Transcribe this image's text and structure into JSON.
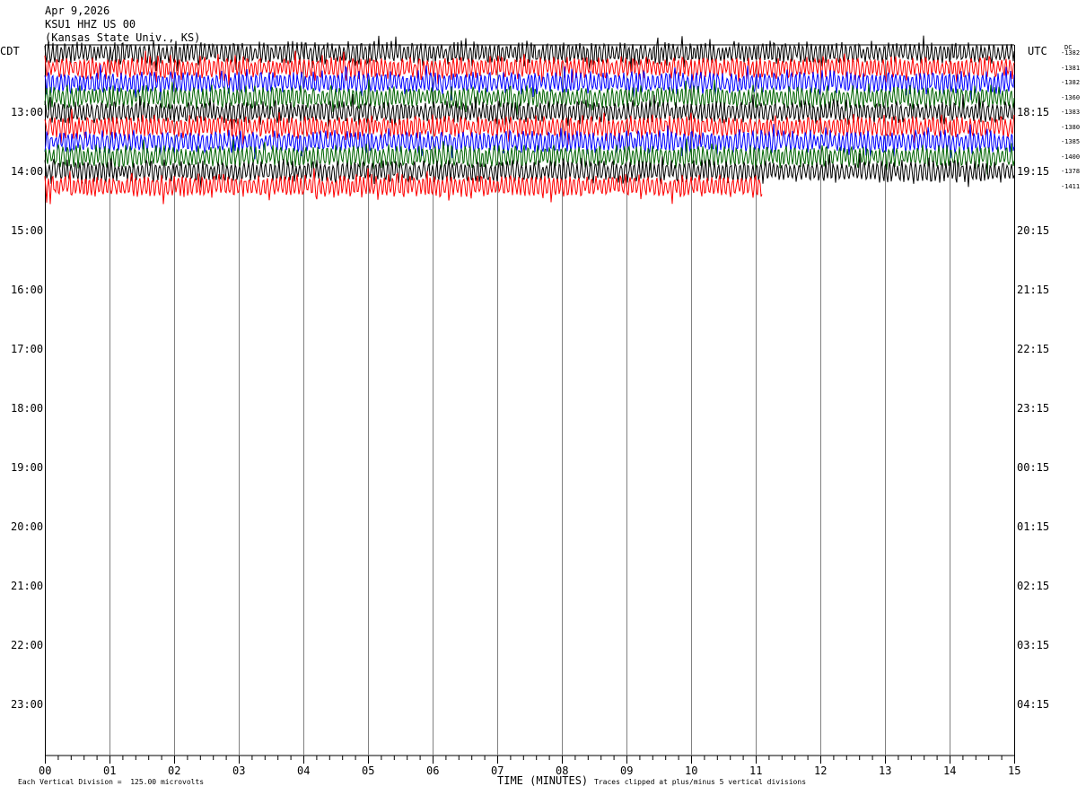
{
  "header": {
    "date": "Apr 9,2026",
    "station": "KSU1 HHZ US 00",
    "location": "(Kansas State Univ., KS)"
  },
  "axes": {
    "left_label": "CDT",
    "right_label": "UTC",
    "dc_label": "DC",
    "xlabel": "TIME (MINUTES)"
  },
  "footer": {
    "scale_note": "Each Vertical Division =  125.00 microvolts",
    "clip_note": "Traces clipped at plus/minus 5 vertical divisions"
  },
  "colors": {
    "trace_colors": [
      "#000000",
      "#ff0000",
      "#0000ff",
      "#006400"
    ],
    "grid": "#808080"
  },
  "chart_data": {
    "type": "line",
    "title": "",
    "xlabel": "TIME (MINUTES)",
    "ylabel": "",
    "xlim": [
      0,
      15
    ],
    "x_ticks": [
      "00",
      "01",
      "02",
      "03",
      "04",
      "05",
      "06",
      "07",
      "08",
      "09",
      "10",
      "11",
      "12",
      "13",
      "14",
      "15"
    ],
    "cdt_labels": [
      "13:00",
      "14:00",
      "15:00",
      "16:00",
      "17:00",
      "18:00",
      "19:00",
      "20:00",
      "21:00",
      "22:00",
      "23:00"
    ],
    "utc_labels": [
      "18:15",
      "19:15",
      "20:15",
      "21:15",
      "22:15",
      "23:15",
      "00:15",
      "01:15",
      "02:15",
      "03:15",
      "04:15"
    ],
    "rows_per_hour": 4,
    "trace_minutes_per_row": 15,
    "dc_offsets": [
      "-1382",
      "-1381",
      "-1382",
      "-1360",
      "-1383",
      "-1380",
      "-1385",
      "-1400",
      "-1378",
      "-1411"
    ],
    "series": [
      {
        "row": 0,
        "color": "#000000",
        "end_minute": 15
      },
      {
        "row": 1,
        "color": "#ff0000",
        "end_minute": 15
      },
      {
        "row": 2,
        "color": "#0000ff",
        "end_minute": 15
      },
      {
        "row": 3,
        "color": "#006400",
        "end_minute": 15
      },
      {
        "row": 4,
        "color": "#000000",
        "end_minute": 15
      },
      {
        "row": 5,
        "color": "#ff0000",
        "end_minute": 15
      },
      {
        "row": 6,
        "color": "#0000ff",
        "end_minute": 15
      },
      {
        "row": 7,
        "color": "#006400",
        "end_minute": 15
      },
      {
        "row": 8,
        "color": "#000000",
        "end_minute": 15
      },
      {
        "row": 9,
        "color": "#ff0000",
        "end_minute": 11.1
      }
    ],
    "scale_microvolts_per_division": 125.0,
    "clip_divisions": 5
  }
}
